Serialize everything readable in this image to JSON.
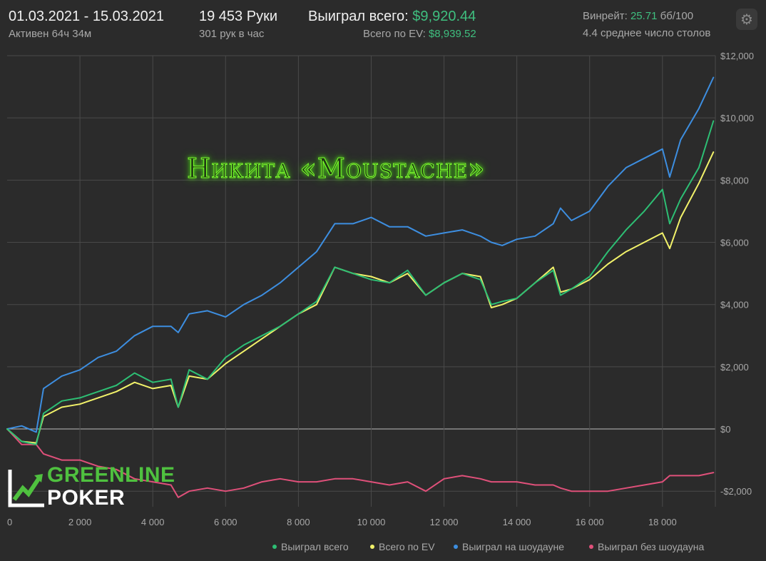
{
  "header": {
    "date_range": "01.03.2021 - 15.03.2021",
    "active_time": "Активен 64ч 34м",
    "hands": "19 453 Руки",
    "hands_per_hour": "301 рук в час",
    "won_total_label": "Выиграл всего:",
    "won_total_value": "$9,920.44",
    "ev_total_label": "Всего по EV:",
    "ev_total_value": "$8,939.52",
    "winrate_label": "Винрейт:",
    "winrate_value": "25.71",
    "winrate_unit": "бб/100",
    "avg_tables": "4.4 среднее число столов"
  },
  "overlay": {
    "player_name": "Никита «Moustache»",
    "logo_line1": "GREENLINE",
    "logo_line2": "POKER"
  },
  "icons": {
    "settings": "gear-icon"
  },
  "colors": {
    "background": "#2b2b2b",
    "grid": "#4a4a4a",
    "won_total": "#2dbf74",
    "ev": "#f2f26a",
    "showdown": "#3d8ee0",
    "non_showdown": "#e0507a",
    "value_green": "#3fbf7f"
  },
  "chart_data": {
    "type": "line",
    "xlim": [
      0,
      19453
    ],
    "ylim": [
      -2500,
      12000
    ],
    "x_ticks": [
      0,
      2000,
      4000,
      6000,
      8000,
      10000,
      12000,
      14000,
      16000,
      18000
    ],
    "x_tick_labels": [
      "0",
      "2 000",
      "4 000",
      "6 000",
      "8 000",
      "10 000",
      "12 000",
      "14 000",
      "16 000",
      "18 000"
    ],
    "y_ticks": [
      -2000,
      0,
      2000,
      4000,
      6000,
      8000,
      10000,
      12000
    ],
    "y_tick_labels": [
      "-$2,000",
      "$0",
      "$2,000",
      "$4,000",
      "$6,000",
      "$8,000",
      "$10,000",
      "$12,000"
    ],
    "grid": true,
    "legend_position": "bottom-right",
    "x": [
      0,
      400,
      800,
      1000,
      1500,
      2000,
      2500,
      3000,
      3500,
      4000,
      4500,
      4700,
      5000,
      5500,
      6000,
      6500,
      7000,
      7500,
      8000,
      8500,
      9000,
      9500,
      10000,
      10500,
      11000,
      11500,
      12000,
      12500,
      13000,
      13300,
      13600,
      14000,
      14500,
      15000,
      15200,
      15500,
      16000,
      16500,
      17000,
      17500,
      18000,
      18200,
      18500,
      19000,
      19400
    ],
    "series": [
      {
        "name": "Выиграл всего",
        "color": "#2dbf74",
        "values": [
          0,
          -400,
          -500,
          500,
          900,
          1000,
          1200,
          1400,
          1800,
          1500,
          1600,
          700,
          1900,
          1600,
          2300,
          2700,
          3000,
          3300,
          3700,
          4100,
          5200,
          5000,
          4800,
          4700,
          5100,
          4300,
          4700,
          5000,
          4800,
          4000,
          4100,
          4200,
          4700,
          5100,
          4300,
          4500,
          4900,
          5700,
          6400,
          7000,
          7700,
          6600,
          7400,
          8400,
          9900
        ]
      },
      {
        "name": "Всего по EV",
        "color": "#f2f26a",
        "values": [
          0,
          -400,
          -450,
          400,
          700,
          800,
          1000,
          1200,
          1500,
          1300,
          1400,
          700,
          1700,
          1600,
          2100,
          2500,
          2900,
          3300,
          3700,
          4000,
          5200,
          5000,
          4900,
          4700,
          5000,
          4300,
          4700,
          5000,
          4900,
          3900,
          4000,
          4200,
          4700,
          5200,
          4400,
          4500,
          4800,
          5300,
          5700,
          6000,
          6300,
          5800,
          6800,
          7900,
          8900
        ]
      },
      {
        "name": "Выиграл на шоудауне",
        "color": "#3d8ee0",
        "values": [
          0,
          100,
          -100,
          1300,
          1700,
          1900,
          2300,
          2500,
          3000,
          3300,
          3300,
          3100,
          3700,
          3800,
          3600,
          4000,
          4300,
          4700,
          5200,
          5700,
          6600,
          6600,
          6800,
          6500,
          6500,
          6200,
          6300,
          6400,
          6200,
          6000,
          5900,
          6100,
          6200,
          6600,
          7100,
          6700,
          7000,
          7800,
          8400,
          8700,
          9000,
          8100,
          9300,
          10300,
          11300
        ]
      },
      {
        "name": "Выиграл без шоудауна",
        "color": "#e0507a",
        "values": [
          0,
          -500,
          -500,
          -800,
          -1000,
          -1000,
          -1200,
          -1300,
          -1600,
          -1700,
          -1800,
          -2200,
          -2000,
          -1900,
          -2000,
          -1900,
          -1700,
          -1600,
          -1700,
          -1700,
          -1600,
          -1600,
          -1700,
          -1800,
          -1700,
          -2000,
          -1600,
          -1500,
          -1600,
          -1700,
          -1700,
          -1700,
          -1800,
          -1800,
          -1900,
          -2000,
          -2000,
          -2000,
          -1900,
          -1800,
          -1700,
          -1500,
          -1500,
          -1500,
          -1400
        ]
      }
    ]
  }
}
